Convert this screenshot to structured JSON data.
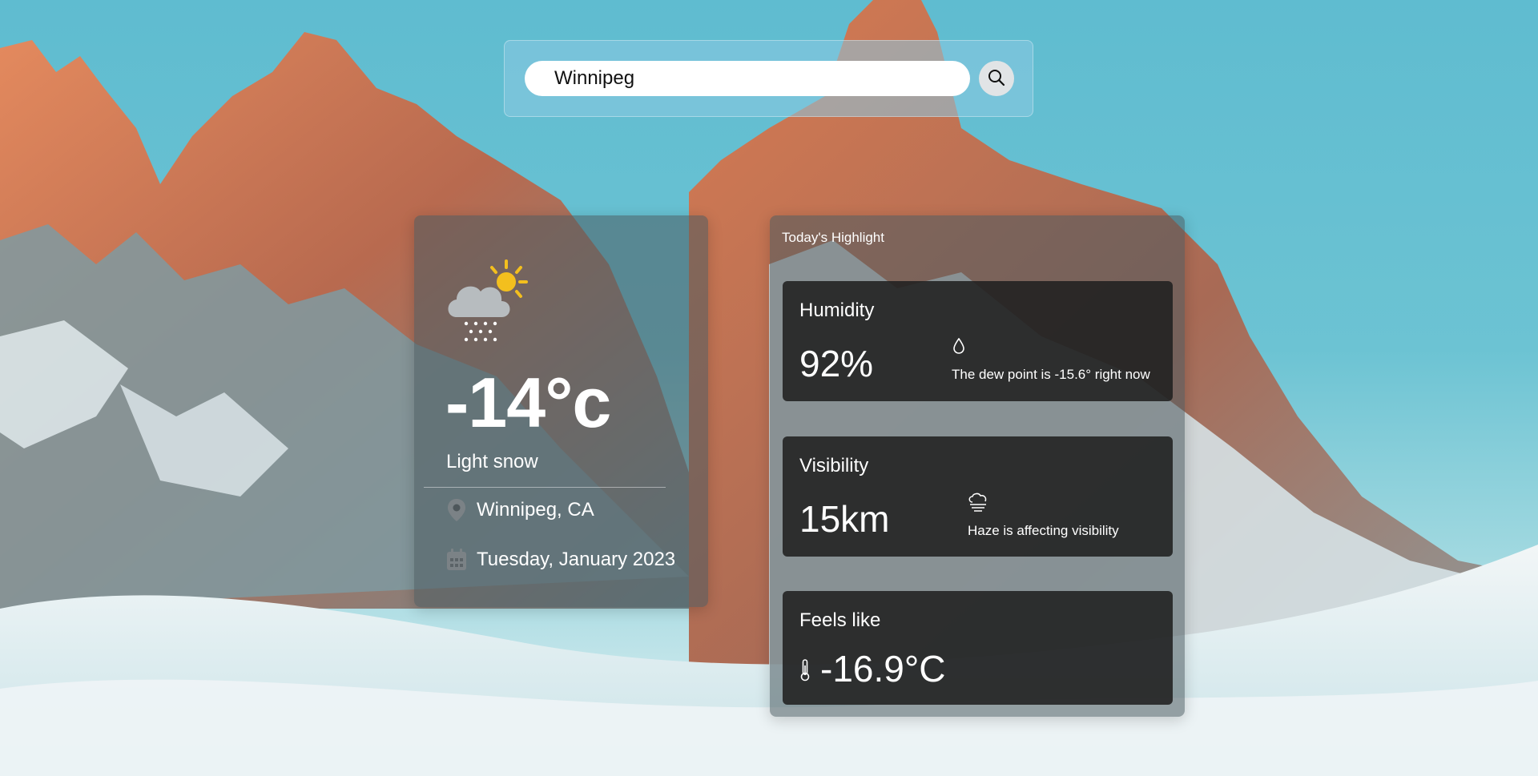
{
  "search": {
    "value": "Winnipeg",
    "button_icon": "search-icon"
  },
  "current": {
    "icon": "snow-sun-cloud-icon",
    "temperature": "-14°c",
    "condition": "Light snow",
    "location": "Winnipeg, CA",
    "location_icon": "location-pin-icon",
    "date": "Tuesday, January 2023",
    "date_icon": "calendar-icon"
  },
  "highlights": {
    "title": "Today's Highlight",
    "humidity": {
      "label": "Humidity",
      "value": "92%",
      "icon": "droplet-icon",
      "note": "The dew point is -15.6° right now"
    },
    "visibility": {
      "label": "Visibility",
      "value": "15km",
      "icon": "haze-icon",
      "note": "Haze is affecting visibility"
    },
    "feels_like": {
      "label": "Feels like",
      "value": "-16.9°C",
      "icon": "thermometer-icon"
    }
  },
  "colors": {
    "sky": "#5fbcd0",
    "card_dark": "#202020",
    "panel_glass": "#4b5a5f"
  }
}
